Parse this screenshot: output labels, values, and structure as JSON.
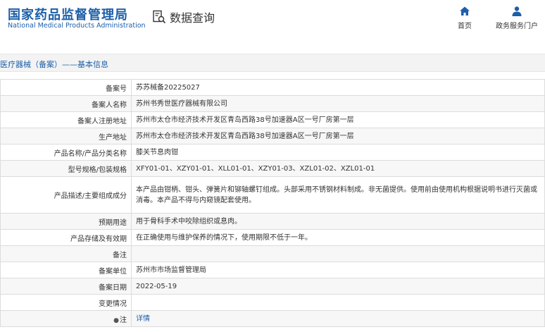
{
  "header": {
    "logo_cn": "国家药品监督管理局",
    "logo_en": "National Medical Products Administration",
    "data_query": "数据查询",
    "nav_home": "首页",
    "nav_gov": "政务服务门户"
  },
  "breadcrumb": "医疗器械（备案）——基本信息",
  "rows": [
    {
      "label": "备案号",
      "value": "苏苏械备20225027"
    },
    {
      "label": "备案人名称",
      "value": "苏州书秀世医疗器械有限公司"
    },
    {
      "label": "备案人注册地址",
      "value": "苏州市太仓市经济技术开发区青岛西路38号加速器A区一号厂房第一层"
    },
    {
      "label": "生产地址",
      "value": "苏州市太仓市经济技术开发区青岛西路38号加速器A区一号厂房第一层"
    },
    {
      "label": "产品名称/产品分类名称",
      "value": "膝关节息肉钳"
    },
    {
      "label": "型号规格/包装规格",
      "value": "XFY01-01、XZY01-01、XLL01-01、XZY01-03、XZL01-02、XZL01-01"
    },
    {
      "label": "产品描述/主要组成成分",
      "value": "本产品由钳柄、钳头、弹簧片和铆轴螺钉组成。头部采用不锈钢材料制成。非无菌提供。使用前由使用机构根据说明书进行灭菌或消毒。本产品不得与内窥镜配套使用。"
    },
    {
      "label": "预期用途",
      "value": "用于骨科手术中咬除组织或息肉。"
    },
    {
      "label": "产品存储及有效期",
      "value": "在正确使用与维护保养的情况下，使用期限不低于一年。"
    },
    {
      "label": "备注",
      "value": ""
    },
    {
      "label": "备案单位",
      "value": "苏州市市场监督管理局"
    },
    {
      "label": "备案日期",
      "value": "2022-05-19"
    },
    {
      "label": "变更情况",
      "value": ""
    },
    {
      "label": "注",
      "value": "详情"
    }
  ]
}
